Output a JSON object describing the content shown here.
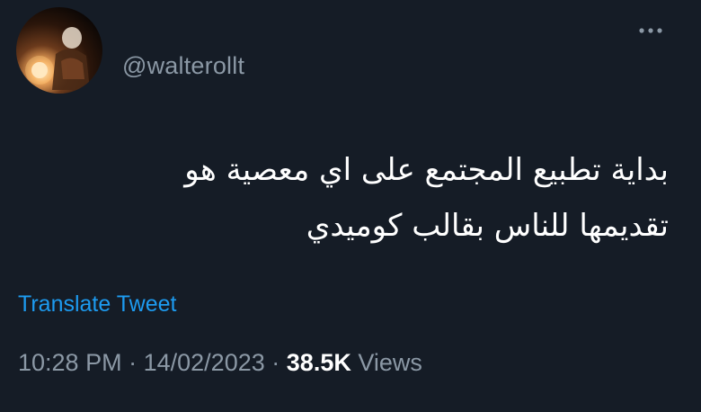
{
  "tweet": {
    "handle": "@walterollt",
    "more_icon": "ellipsis-icon",
    "avatar_icon": "profile-photo",
    "text_line1": "بداية تطبيع المجتمع على اي معصية هو",
    "text_line2": "تقديمها للناس بقالب كوميدي",
    "translate_label": "Translate Tweet",
    "time": "10:28 PM",
    "separator": "·",
    "date": "14/02/2023",
    "views_count": "38.5K",
    "views_label": "Views"
  },
  "colors": {
    "background": "#151c26",
    "text": "#ffffff",
    "muted": "#8b98a5",
    "link": "#1d9bf0"
  }
}
